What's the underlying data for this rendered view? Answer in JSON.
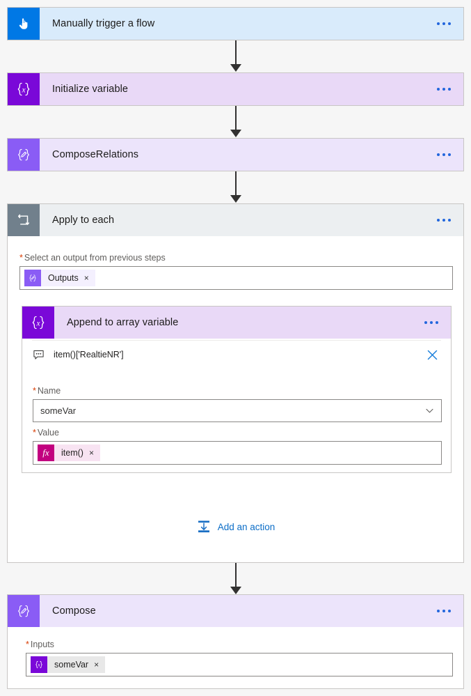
{
  "flow": {
    "steps": [
      {
        "id": "manual-trigger",
        "title": "Manually trigger a flow",
        "icon": "hand-tap-icon",
        "menu_label": "…"
      },
      {
        "id": "initialize-variable",
        "title": "Initialize variable",
        "icon": "variable-braces-icon",
        "menu_label": "…"
      },
      {
        "id": "compose-relations",
        "title": "ComposeRelations",
        "icon": "compose-pencil-icon",
        "menu_label": "…"
      },
      {
        "id": "apply-to-each",
        "title": "Apply to each",
        "icon": "loop-icon",
        "menu_label": "…"
      },
      {
        "id": "compose",
        "title": "Compose",
        "icon": "compose-pencil-icon",
        "menu_label": "…"
      }
    ]
  },
  "apply_to_each": {
    "select_output_label": "Select an output from previous steps",
    "required_marker": "*",
    "output_token": {
      "text": "Outputs",
      "icon": "compose-pencil-icon",
      "remove_label": "×"
    },
    "add_action_label": "Add an action",
    "add_action_icon": "insert-action-icon"
  },
  "append_action": {
    "title": "Append to array variable",
    "icon": "variable-braces-icon",
    "menu_label": "…",
    "dynamic_expression": {
      "text": "item()['RealtieNR']",
      "icon": "comment-bubble-icon",
      "close_label": "×"
    },
    "name_field": {
      "label": "Name",
      "required_marker": "*",
      "value": "someVar",
      "chevron_icon": "chevron-down-icon"
    },
    "value_field": {
      "label": "Value",
      "required_marker": "*",
      "token": {
        "text": "item()",
        "icon": "fx-icon",
        "icon_label": "fx",
        "remove_label": "×"
      }
    }
  },
  "compose_action": {
    "inputs_label": "Inputs",
    "required_marker": "*",
    "token": {
      "text": "someVar",
      "icon": "variable-braces-icon",
      "remove_label": "×"
    }
  },
  "colors": {
    "trigger_header": "#d9ebfb",
    "trigger_icon": "#0078e5",
    "variable_header": "#e9d9f7",
    "variable_icon": "#7a08d8",
    "compose_header": "#ece4fb",
    "compose_icon": "#8a5cf5",
    "loop_header": "#eceff1",
    "loop_icon": "#71808c",
    "fx_token": "#c2007f",
    "link_blue": "#0b6dc7",
    "required_red": "#d83b01",
    "canvas_bg": "#f6f6f6"
  }
}
